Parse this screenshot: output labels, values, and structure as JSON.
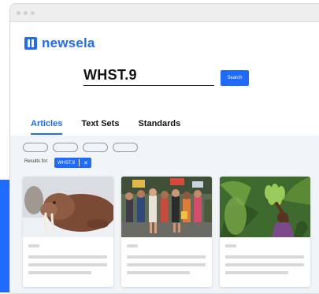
{
  "brand": {
    "name": "newsela",
    "color": "#1f6bff"
  },
  "search": {
    "value": "WHST.9",
    "button_label": "Search"
  },
  "tabs": [
    {
      "label": "Articles",
      "active": true
    },
    {
      "label": "Text Sets",
      "active": false
    },
    {
      "label": "Standards",
      "active": false
    }
  ],
  "filters": {
    "chip_count": 4
  },
  "results": {
    "label": "Results for:",
    "tag": "WHST.9",
    "tag_close": "✕"
  },
  "cards": [
    {
      "image": "walrus-photo"
    },
    {
      "image": "street-protest-crowd-photo"
    },
    {
      "image": "person-harvesting-bananas-photo"
    }
  ]
}
